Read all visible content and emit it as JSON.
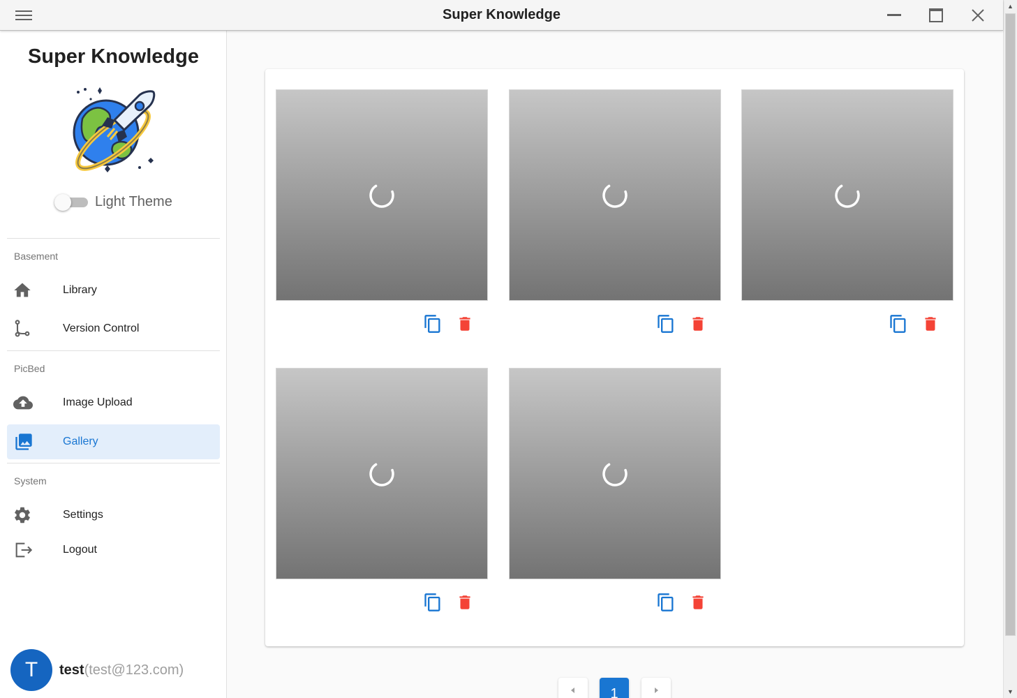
{
  "window": {
    "title": "Super Knowledge"
  },
  "sidebar": {
    "brand": "Super Knowledge",
    "theme_toggle": {
      "label": "Light Theme",
      "enabled": false
    },
    "sections": [
      {
        "title": "Basement",
        "items": [
          {
            "label": "Library",
            "icon": "home-icon"
          },
          {
            "label": "Version Control",
            "icon": "source-branch-icon"
          }
        ]
      },
      {
        "title": "PicBed",
        "items": [
          {
            "label": "Image Upload",
            "icon": "cloud-upload-icon"
          },
          {
            "label": "Gallery",
            "icon": "image-multiple-icon",
            "active": true
          }
        ]
      },
      {
        "title": "System",
        "items": [
          {
            "label": "Settings",
            "icon": "gear-icon"
          },
          {
            "label": "Logout",
            "icon": "logout-icon"
          }
        ]
      }
    ],
    "user": {
      "initial": "T",
      "name": "test",
      "email": "(test@123.com)"
    }
  },
  "gallery": {
    "images": [
      {
        "state": "loading"
      },
      {
        "state": "loading"
      },
      {
        "state": "loading"
      },
      {
        "state": "loading"
      },
      {
        "state": "loading"
      }
    ],
    "colors": {
      "copy": "#1976d2",
      "delete": "#f44336"
    }
  },
  "pagination": {
    "current_page": "1",
    "prev_icon": "chevron-left-icon",
    "next_icon": "chevron-right-icon"
  }
}
